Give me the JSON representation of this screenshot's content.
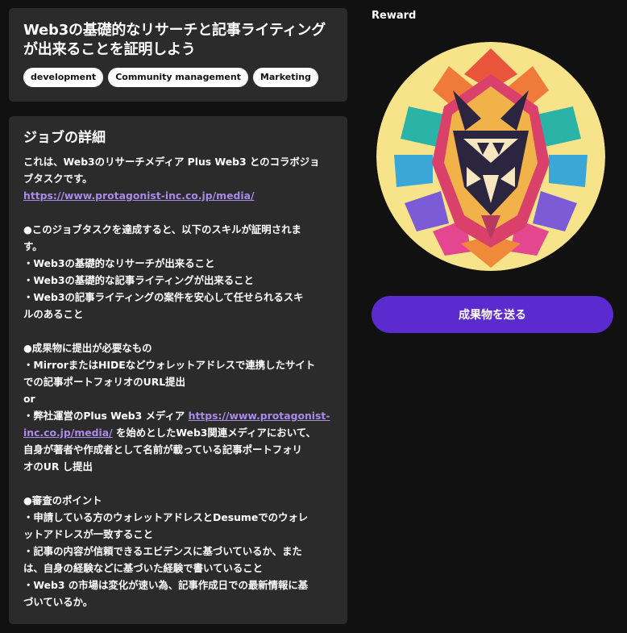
{
  "job": {
    "title_line1": "Web3の基礎的なリサーチと記事ライティング",
    "title_line2": "が出来ることを証明しよう",
    "tags": [
      "development",
      "Community management",
      "Marketing"
    ]
  },
  "detail": {
    "heading": "ジョブの詳細",
    "intro_line1": "これは、Web3のリサーチメディア Plus Web3 とのコラボジョ",
    "intro_line2": "ブタスクです。",
    "intro_link": "https://www.protagonist-inc.co.jp/media/",
    "skills_head_line1": "●このジョブタスクを達成すると、以下のスキルが証明されま",
    "skills_head_line2": "す。",
    "skill_1": "・Web3の基礎的なリサーチが出来ること",
    "skill_2": "・Web3の基礎的な記事ライティングが出来ること",
    "skill_3_line1": "・Web3の記事ライティングの案件を安心して任せられるスキ",
    "skill_3_line2": "ルのあること",
    "deliverable_head": "●成果物に提出が必要なもの",
    "deliverable_1_line1": "・MirrorまたはHIDEなどウォレットアドレスで連携したサイト",
    "deliverable_1_line2": "での記事ポートフォリオのURL提出",
    "or_text": "or",
    "deliverable_2_prefix": "・弊社運営のPlus Web3 メディア ",
    "deliverable_2_link_part1": "https://www.protagonist-",
    "deliverable_2_link_part2": "inc.co.jp/media/",
    "deliverable_2_suffix": " を始めとしたWeb3関連メディアにおいて、",
    "deliverable_2_line3": "自身が著者や作成者として名前が載っている記事ポートフォリ",
    "deliverable_2_line4": "オのUR し提出",
    "review_head": "●審査のポイント",
    "review_1_line1": "・申請している方のウォレットアドレスとDesumeでのウォレ",
    "review_1_line2": "ットアドレスが一致すること",
    "review_2_line1": "・記事の内容が信頼できるエビデンスに基づいているか、また",
    "review_2_line2": "は、自身の経験などに基づいた経験で書いていること",
    "review_3_line1": "・Web3 の市場は変化が速い為、記事作成日での最新情報に基",
    "review_3_line2": "づいているか。"
  },
  "reward": {
    "label": "Reward",
    "image_icon": "geometric-wolf-icon"
  },
  "actions": {
    "submit_label": "成果物を送る"
  },
  "colors": {
    "background": "#111111",
    "card": "#2b2b2b",
    "accent": "#5b2bd0",
    "link": "#a98be8"
  }
}
